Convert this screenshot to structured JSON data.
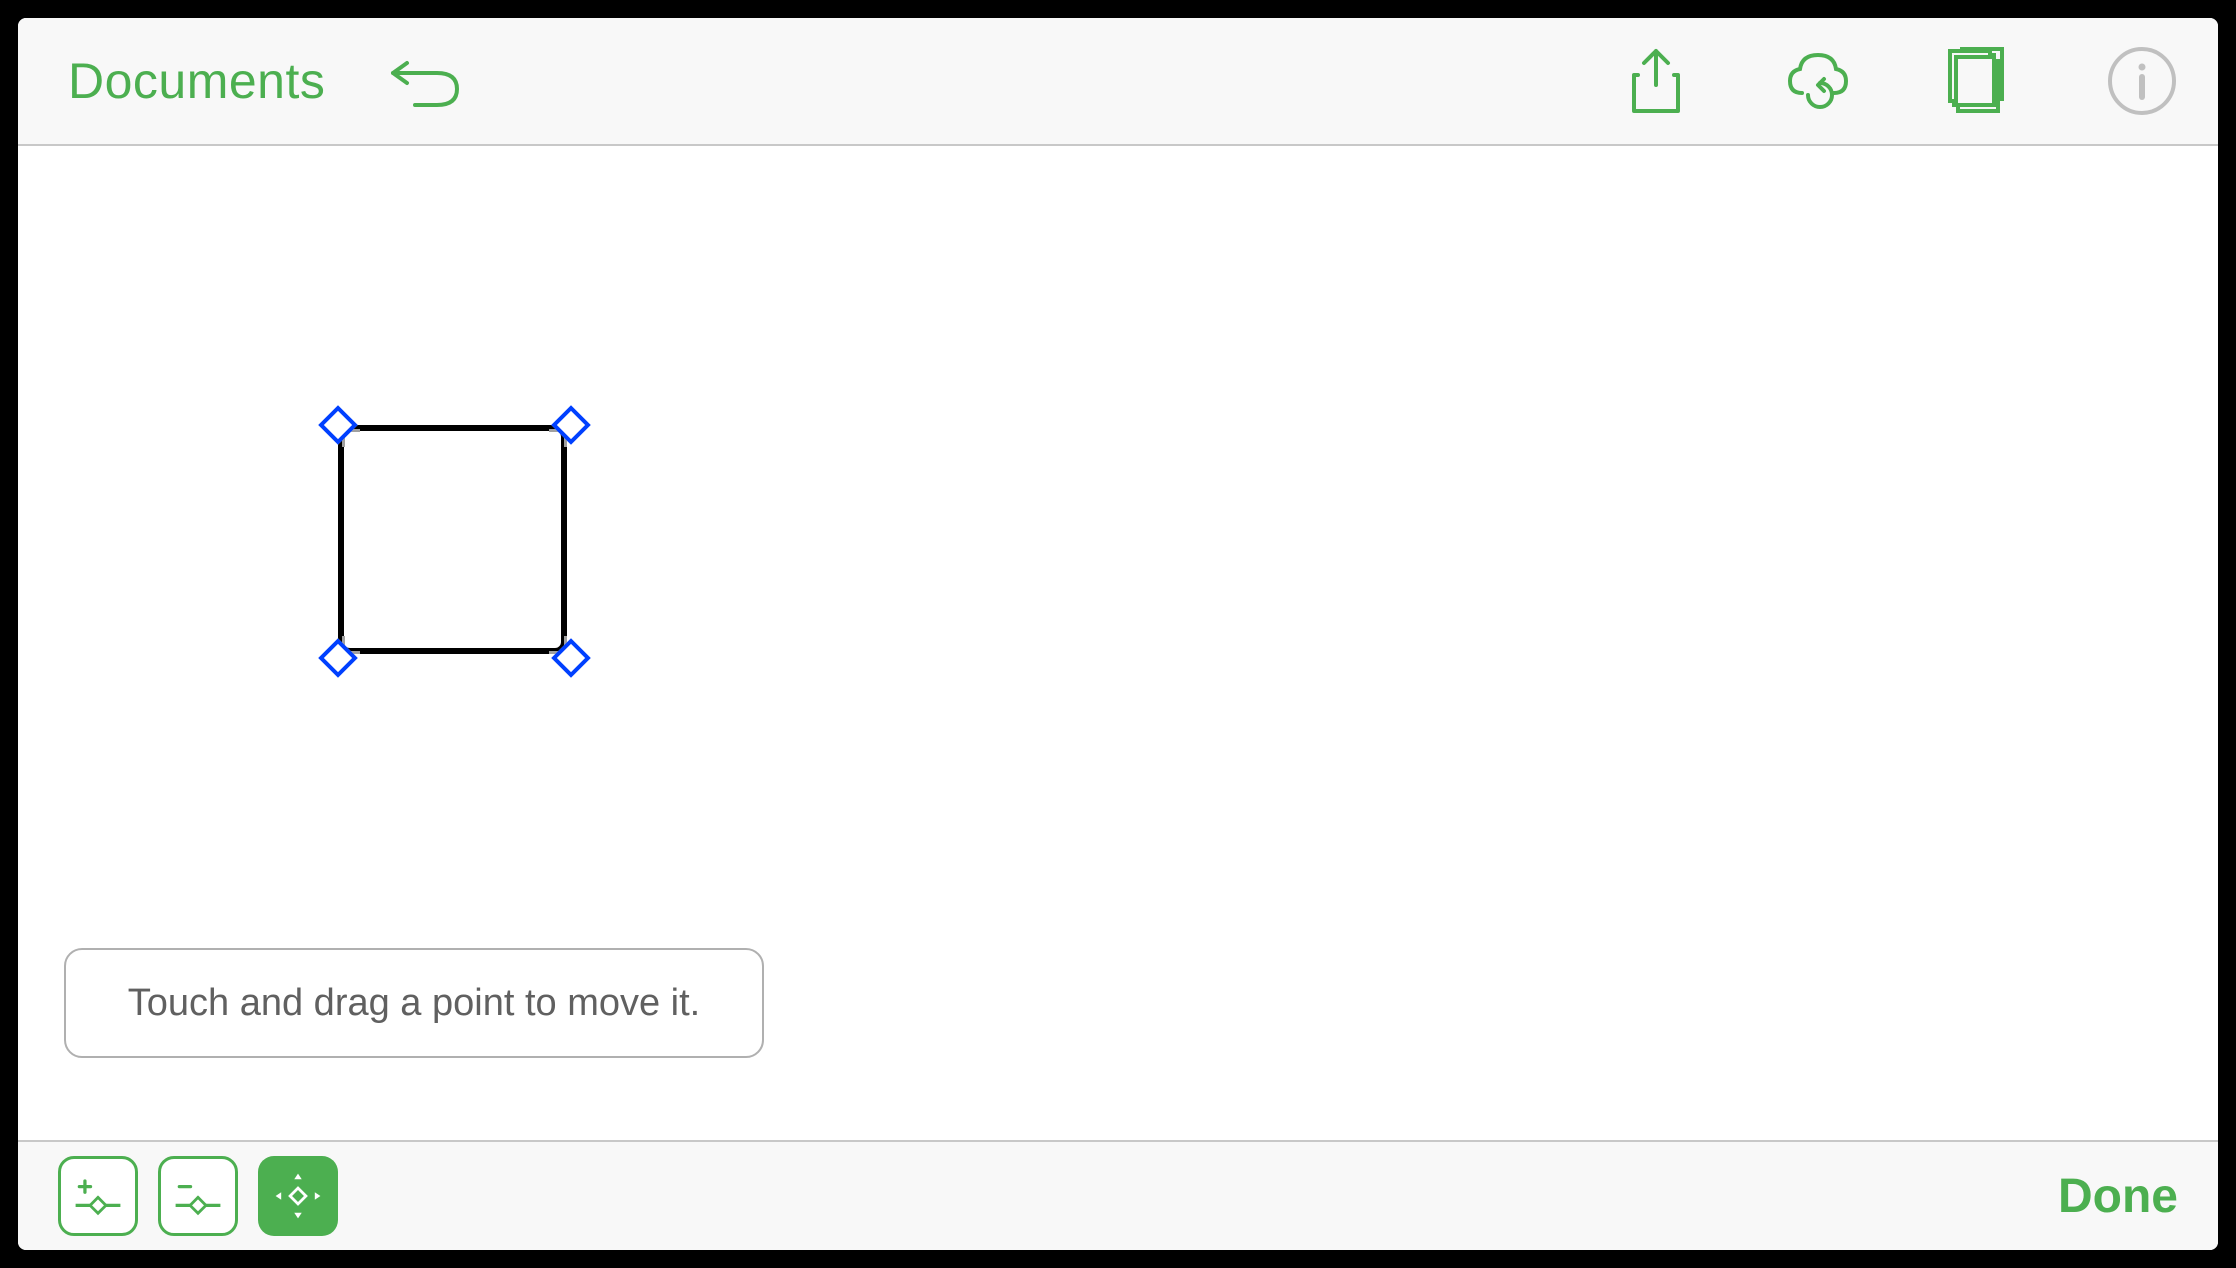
{
  "colors": {
    "accent": "#4CAF50",
    "handle": "#0040ff"
  },
  "toolbar": {
    "documents_label": "Documents"
  },
  "canvas": {
    "hint_text": "Touch and drag a point to move it."
  },
  "bottom": {
    "done_label": "Done"
  }
}
